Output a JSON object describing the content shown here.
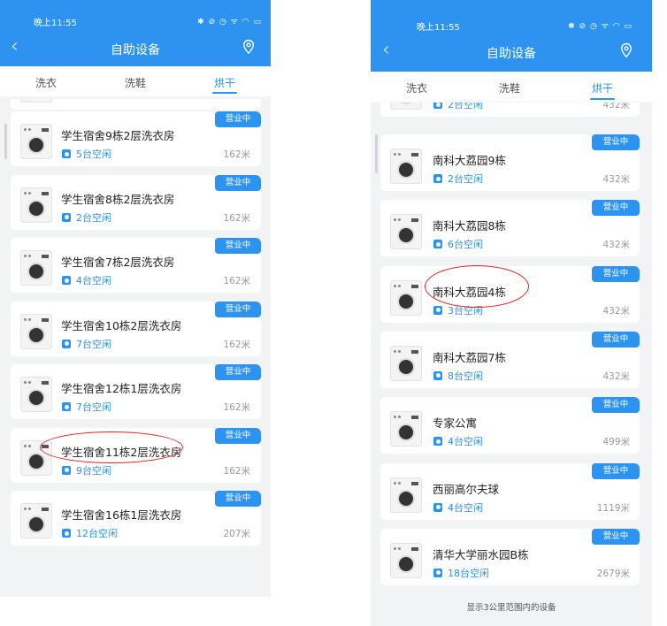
{
  "left": {
    "status_time": "晚上11:55",
    "status_icons": "✱ ⊘ ◷ ᯤ ◠ ▭",
    "title": "自助设备",
    "tabs": [
      "洗衣",
      "洗鞋",
      "烘干"
    ],
    "active_tab": 2,
    "items": [
      {
        "name": "学生宿舍9栋2层洗衣房",
        "idle": "5台空闲",
        "distance": "162米",
        "badge": "营业中"
      },
      {
        "name": "学生宿舍8栋2层洗衣房",
        "idle": "2台空闲",
        "distance": "162米",
        "badge": "营业中"
      },
      {
        "name": "学生宿舍7栋2层洗衣房",
        "idle": "4台空闲",
        "distance": "162米",
        "badge": "营业中"
      },
      {
        "name": "学生宿舍10栋2层洗衣房",
        "idle": "7台空闲",
        "distance": "162米",
        "badge": "营业中"
      },
      {
        "name": "学生宿舍12栋1层洗衣房",
        "idle": "7台空闲",
        "distance": "162米",
        "badge": "营业中"
      },
      {
        "name": "学生宿舍11栋2层洗衣房",
        "idle": "9台空闲",
        "distance": "162米",
        "badge": "营业中"
      },
      {
        "name": "学生宿舍16栋1层洗衣房",
        "idle": "12台空闲",
        "distance": "207米",
        "badge": "营业中"
      }
    ]
  },
  "right": {
    "status_time": "晚上11:55",
    "status_icons": "✱ ⊘ ◷ ᯤ ◠ ▭",
    "title": "自助设备",
    "tabs": [
      "洗衣",
      "洗鞋",
      "烘干"
    ],
    "active_tab": 2,
    "partial_item": {
      "idle": "2台空闲",
      "distance": "432米"
    },
    "items": [
      {
        "name": "南科大荔园9栋",
        "idle": "2台空闲",
        "distance": "432米",
        "badge": "营业中"
      },
      {
        "name": "南科大荔园8栋",
        "idle": "6台空闲",
        "distance": "432米",
        "badge": "营业中"
      },
      {
        "name": "南科大荔园4栋",
        "idle": "3台空闲",
        "distance": "432米",
        "badge": "营业中"
      },
      {
        "name": "南科大荔园7栋",
        "idle": "8台空闲",
        "distance": "432米",
        "badge": "营业中"
      },
      {
        "name": "专家公寓",
        "idle": "4台空闲",
        "distance": "499米",
        "badge": "营业中"
      },
      {
        "name": "西丽高尔夫球",
        "idle": "4台空闲",
        "distance": "1119米",
        "badge": "营业中"
      },
      {
        "name": "清华大学丽水园B栋",
        "idle": "18台空闲",
        "distance": "2679米",
        "badge": "营业中"
      }
    ],
    "footer": "显示3公里范围内的设备"
  },
  "colors": {
    "primary": "#2c93f0",
    "annotation": "#dd2222",
    "background": "#f2f3f5"
  }
}
